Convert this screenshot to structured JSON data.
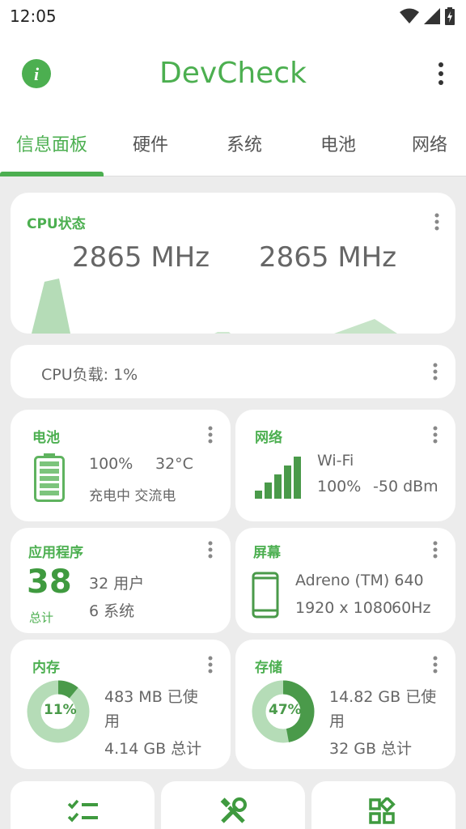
{
  "statusbar": {
    "time": "12:05"
  },
  "app": {
    "title": "DevCheck"
  },
  "tabs": [
    {
      "label": "信息面板"
    },
    {
      "label": "硬件"
    },
    {
      "label": "系统"
    },
    {
      "label": "电池"
    },
    {
      "label": "网络"
    }
  ],
  "cpu": {
    "title": "CPU状态",
    "freq1": "2865 MHz",
    "freq2": "2865 MHz"
  },
  "cpuload": {
    "text": "CPU负载: 1%"
  },
  "battery": {
    "title": "电池",
    "level": "100%",
    "temp": "32°C",
    "status": "充电中 交流电"
  },
  "network": {
    "title": "网络",
    "type": "Wi-Fi",
    "signal": "100%",
    "dbm": "-50 dBm"
  },
  "apps": {
    "title": "应用程序",
    "count": "38",
    "count_label": "总计",
    "user": "32 用户",
    "system": "6 系统"
  },
  "display": {
    "title": "屏幕",
    "gpu": "Adreno (TM) 640",
    "resolution": "1920 x 1080",
    "refresh": "60Hz"
  },
  "memory": {
    "title": "内存",
    "percent": "11%",
    "percent_value": 11,
    "used_line1": "483 MB 已使",
    "used_line2": "用",
    "total": "4.14 GB 总计"
  },
  "storage": {
    "title": "存储",
    "percent": "47%",
    "percent_value": 47,
    "used_line1": "14.82 GB 已使",
    "used_line2": "用",
    "total": "32 GB 总计"
  },
  "colors": {
    "accent": "#4caf50",
    "accent_dark": "#3f9a3f",
    "light_green": "#a5d6a7"
  },
  "bottom_icons": [
    "checklist-icon",
    "tools-icon",
    "widgets-icon"
  ]
}
